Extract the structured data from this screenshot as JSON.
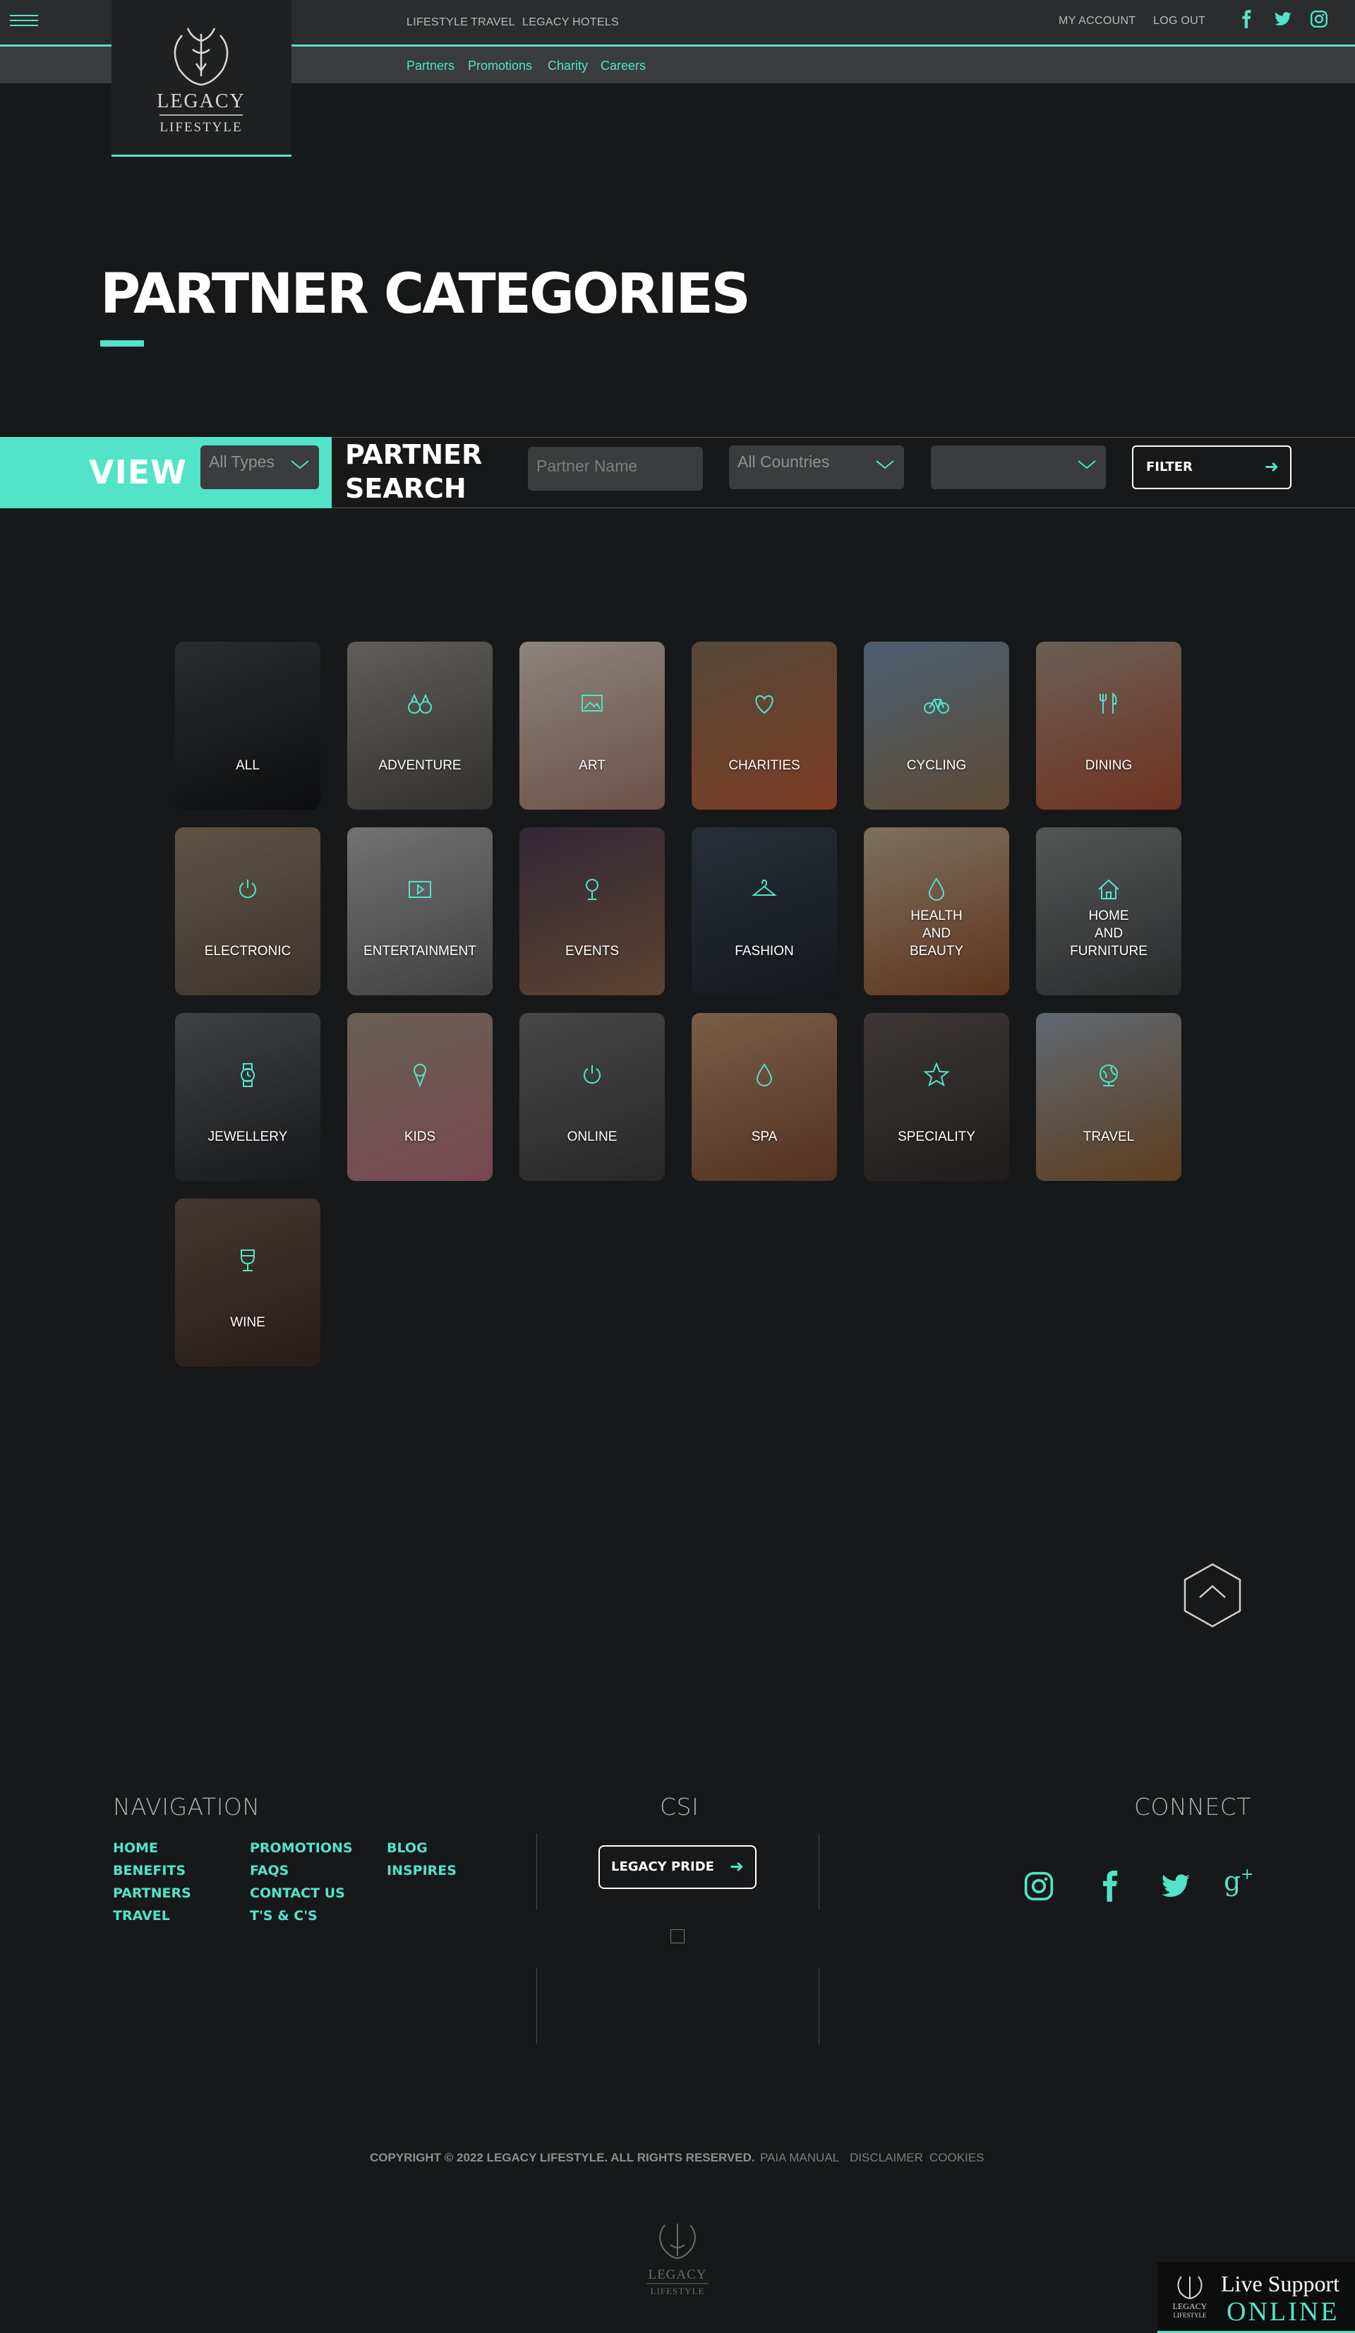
{
  "header": {
    "top_links": [
      "LIFESTYLE",
      "TRAVEL",
      "LEGACY HOTELS"
    ],
    "account_links": [
      "MY ACCOUNT",
      "LOG OUT"
    ],
    "social_icons": [
      "facebook-icon",
      "twitter-icon",
      "instagram-icon"
    ],
    "sub_links": [
      "Partners",
      "Promotions",
      "Charity",
      "Careers"
    ],
    "logo": {
      "line1": "LEGACY",
      "line2": "LIFESTYLE"
    }
  },
  "page": {
    "title": "PARTNER CATEGORIES"
  },
  "search": {
    "view_label": "VIEW",
    "type_select": "All Types",
    "partner_search_label_1": "PARTNER",
    "partner_search_label_2": "SEARCH",
    "partner_name_placeholder": "Partner Name",
    "country_select": "All Countries",
    "third_select": "",
    "filter_label": "FILTER"
  },
  "categories": [
    {
      "label": "ALL",
      "icon": "car-icon",
      "colors": [
        "#3e4247",
        "#121416"
      ]
    },
    {
      "label": "ADVENTURE",
      "icon": "binoculars-icon",
      "colors": [
        "#8e8a84",
        "#4b4843"
      ]
    },
    {
      "label": "ART",
      "icon": "picture-icon",
      "colors": [
        "#cfc2ba",
        "#a0786a"
      ]
    },
    {
      "label": "CHARITIES",
      "icon": "heart-icon",
      "colors": [
        "#7d6a55",
        "#b85a35"
      ]
    },
    {
      "label": "CYCLING",
      "icon": "bicycle-icon",
      "colors": [
        "#6e8aa8",
        "#8a6f4c"
      ]
    },
    {
      "label": "DINING",
      "icon": "cutlery-icon",
      "colors": [
        "#9c8c7c",
        "#a54a32"
      ]
    },
    {
      "label": "ELECTRONIC",
      "icon": "power-icon",
      "colors": [
        "#8d7b66",
        "#5a4e42"
      ]
    },
    {
      "label": "ENTERTAINMENT",
      "icon": "video-play-icon",
      "colors": [
        "#a8a8a8",
        "#5f5f5f"
      ]
    },
    {
      "label": "EVENTS",
      "icon": "microphone-icon",
      "colors": [
        "#4a3a50",
        "#8a6448"
      ]
    },
    {
      "label": "FASHION",
      "icon": "hanger-icon",
      "colors": [
        "#3c4552",
        "#1e242b"
      ]
    },
    {
      "label": "HEALTH AND BEAUTY",
      "icon": "drop-icon",
      "colors": [
        "#b8a58c",
        "#8a4d2d"
      ]
    },
    {
      "label": "HOME AND FURNITURE",
      "icon": "home-icon",
      "colors": [
        "#7c7f80",
        "#3d4042"
      ]
    },
    {
      "label": "JEWELLERY",
      "icon": "watch-icon",
      "colors": [
        "#5d6064",
        "#222426"
      ]
    },
    {
      "label": "KIDS",
      "icon": "ice-cream-icon",
      "colors": [
        "#9a8c7c",
        "#b06a7a"
      ]
    },
    {
      "label": "ONLINE",
      "icon": "power-icon",
      "colors": [
        "#6a6a6a",
        "#3a3a3a"
      ]
    },
    {
      "label": "SPA",
      "icon": "drop-icon",
      "colors": [
        "#b08a6a",
        "#7a4a32"
      ]
    },
    {
      "label": "SPECIALITY",
      "icon": "star-icon",
      "colors": [
        "#5a5250",
        "#2e2a28"
      ]
    },
    {
      "label": "TRAVEL",
      "icon": "globe-icon",
      "colors": [
        "#8c9aa8",
        "#8a5a2e"
      ]
    },
    {
      "label": "WINE",
      "icon": "wine-glass-icon",
      "colors": [
        "#6a5048",
        "#3a2a26"
      ]
    }
  ],
  "footer": {
    "navigation_heading": "NAVIGATION",
    "nav_col1": [
      "HOME",
      "BENEFITS",
      "PARTNERS",
      "TRAVEL"
    ],
    "nav_col2": [
      "PROMOTIONS",
      "FAQS",
      "CONTACT US",
      "T'S & C'S"
    ],
    "nav_col3": [
      "BLOG",
      "INSPIRES"
    ],
    "csi_heading": "CSI",
    "pride_button": "LEGACY PRIDE",
    "connect_heading": "CONNECT",
    "connect_icons": [
      "instagram-icon",
      "facebook-icon",
      "twitter-icon",
      "google-plus-icon"
    ],
    "copyright": "COPYRIGHT © 2022 LEGACY LIFESTYLE. ALL RIGHTS RESERVED.",
    "legal_links": [
      "PAIA MANUAL",
      "DISCLAIMER",
      "COOKIES"
    ]
  },
  "live_support": {
    "line1": "Live Support",
    "line2": "ONLINE"
  }
}
